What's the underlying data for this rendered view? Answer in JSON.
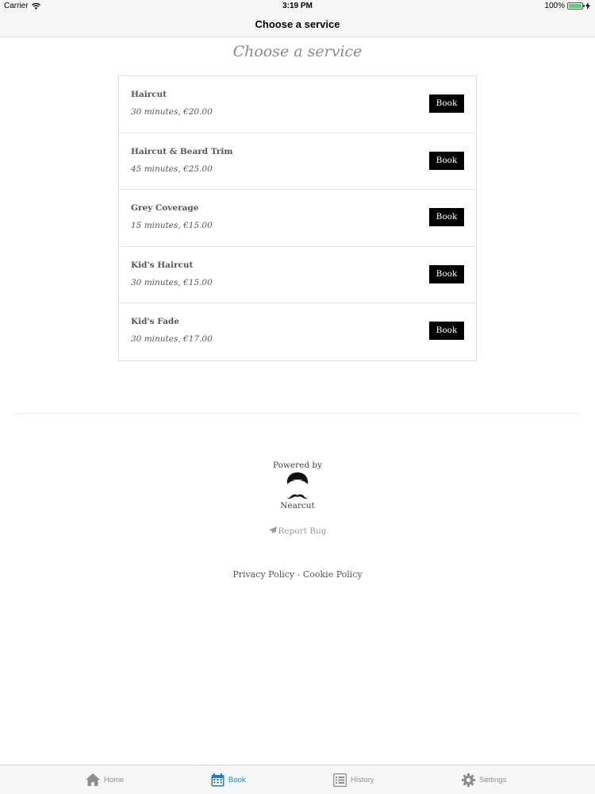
{
  "status_bar": {
    "carrier": "Carrier",
    "time": "3:19 PM",
    "battery": "100%"
  },
  "nav": {
    "title": "Choose a service"
  },
  "heading": "Choose a service",
  "services": [
    {
      "name": "Haircut",
      "details": "30 minutes, €20.00",
      "action": "Book"
    },
    {
      "name": "Haircut & Beard Trim",
      "details": "45 minutes, €25.00",
      "action": "Book"
    },
    {
      "name": "Grey Coverage",
      "details": "15 minutes, €15.00",
      "action": "Book"
    },
    {
      "name": "Kid's Haircut",
      "details": "30 minutes, €15.00",
      "action": "Book"
    },
    {
      "name": "Kid's Fade",
      "details": "30 minutes, €17.00",
      "action": "Book"
    }
  ],
  "footer": {
    "powered_by": "Powered by",
    "brand": "Nearcut",
    "report_bug": "Report Bug",
    "privacy_policy": "Privacy Policy",
    "separator": "-",
    "cookie_policy": "Cookie Policy"
  },
  "tabs": [
    {
      "label": "Home",
      "icon": "home-icon",
      "active": false
    },
    {
      "label": "Book",
      "icon": "calendar-icon",
      "active": true
    },
    {
      "label": "History",
      "icon": "list-icon",
      "active": false
    },
    {
      "label": "Settings",
      "icon": "gear-icon",
      "active": false
    }
  ],
  "colors": {
    "accent": "#1a82d6",
    "button": "#000000",
    "tab_inactive": "#8e8e8e"
  }
}
